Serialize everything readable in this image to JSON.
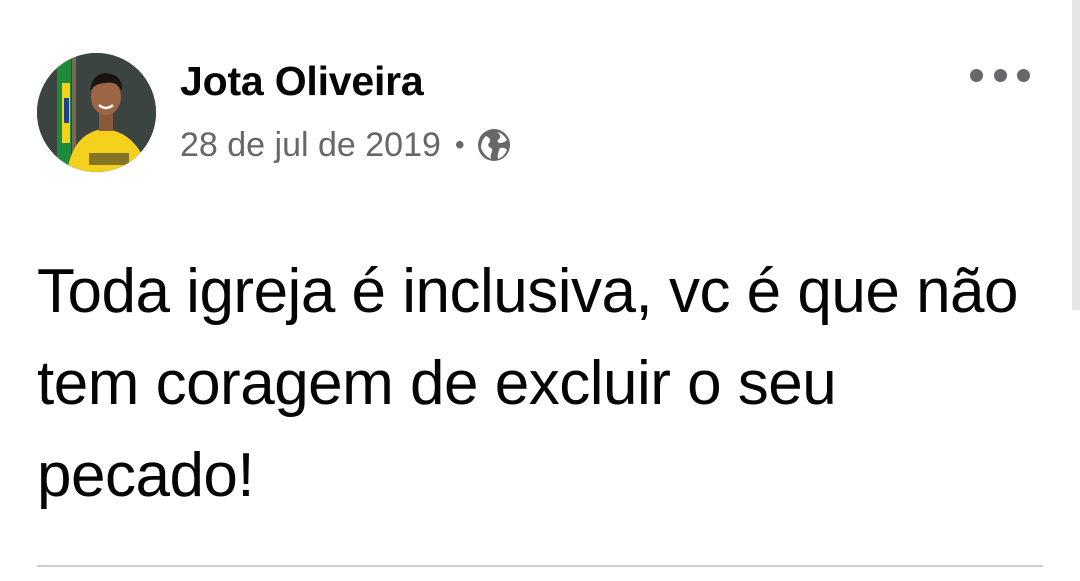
{
  "post": {
    "author_name": "Jota Oliveira",
    "timestamp": "28 de jul de 2019",
    "separator": "•",
    "privacy_icon": "globe-icon",
    "more_icon": "more-options-icon",
    "text": "Toda igreja é inclusiva, vc é que não tem coragem de excluir o seu pecado!"
  },
  "colors": {
    "text_primary": "#050505",
    "text_secondary": "#65676b",
    "divider": "#ced0d4",
    "background": "#ffffff"
  }
}
